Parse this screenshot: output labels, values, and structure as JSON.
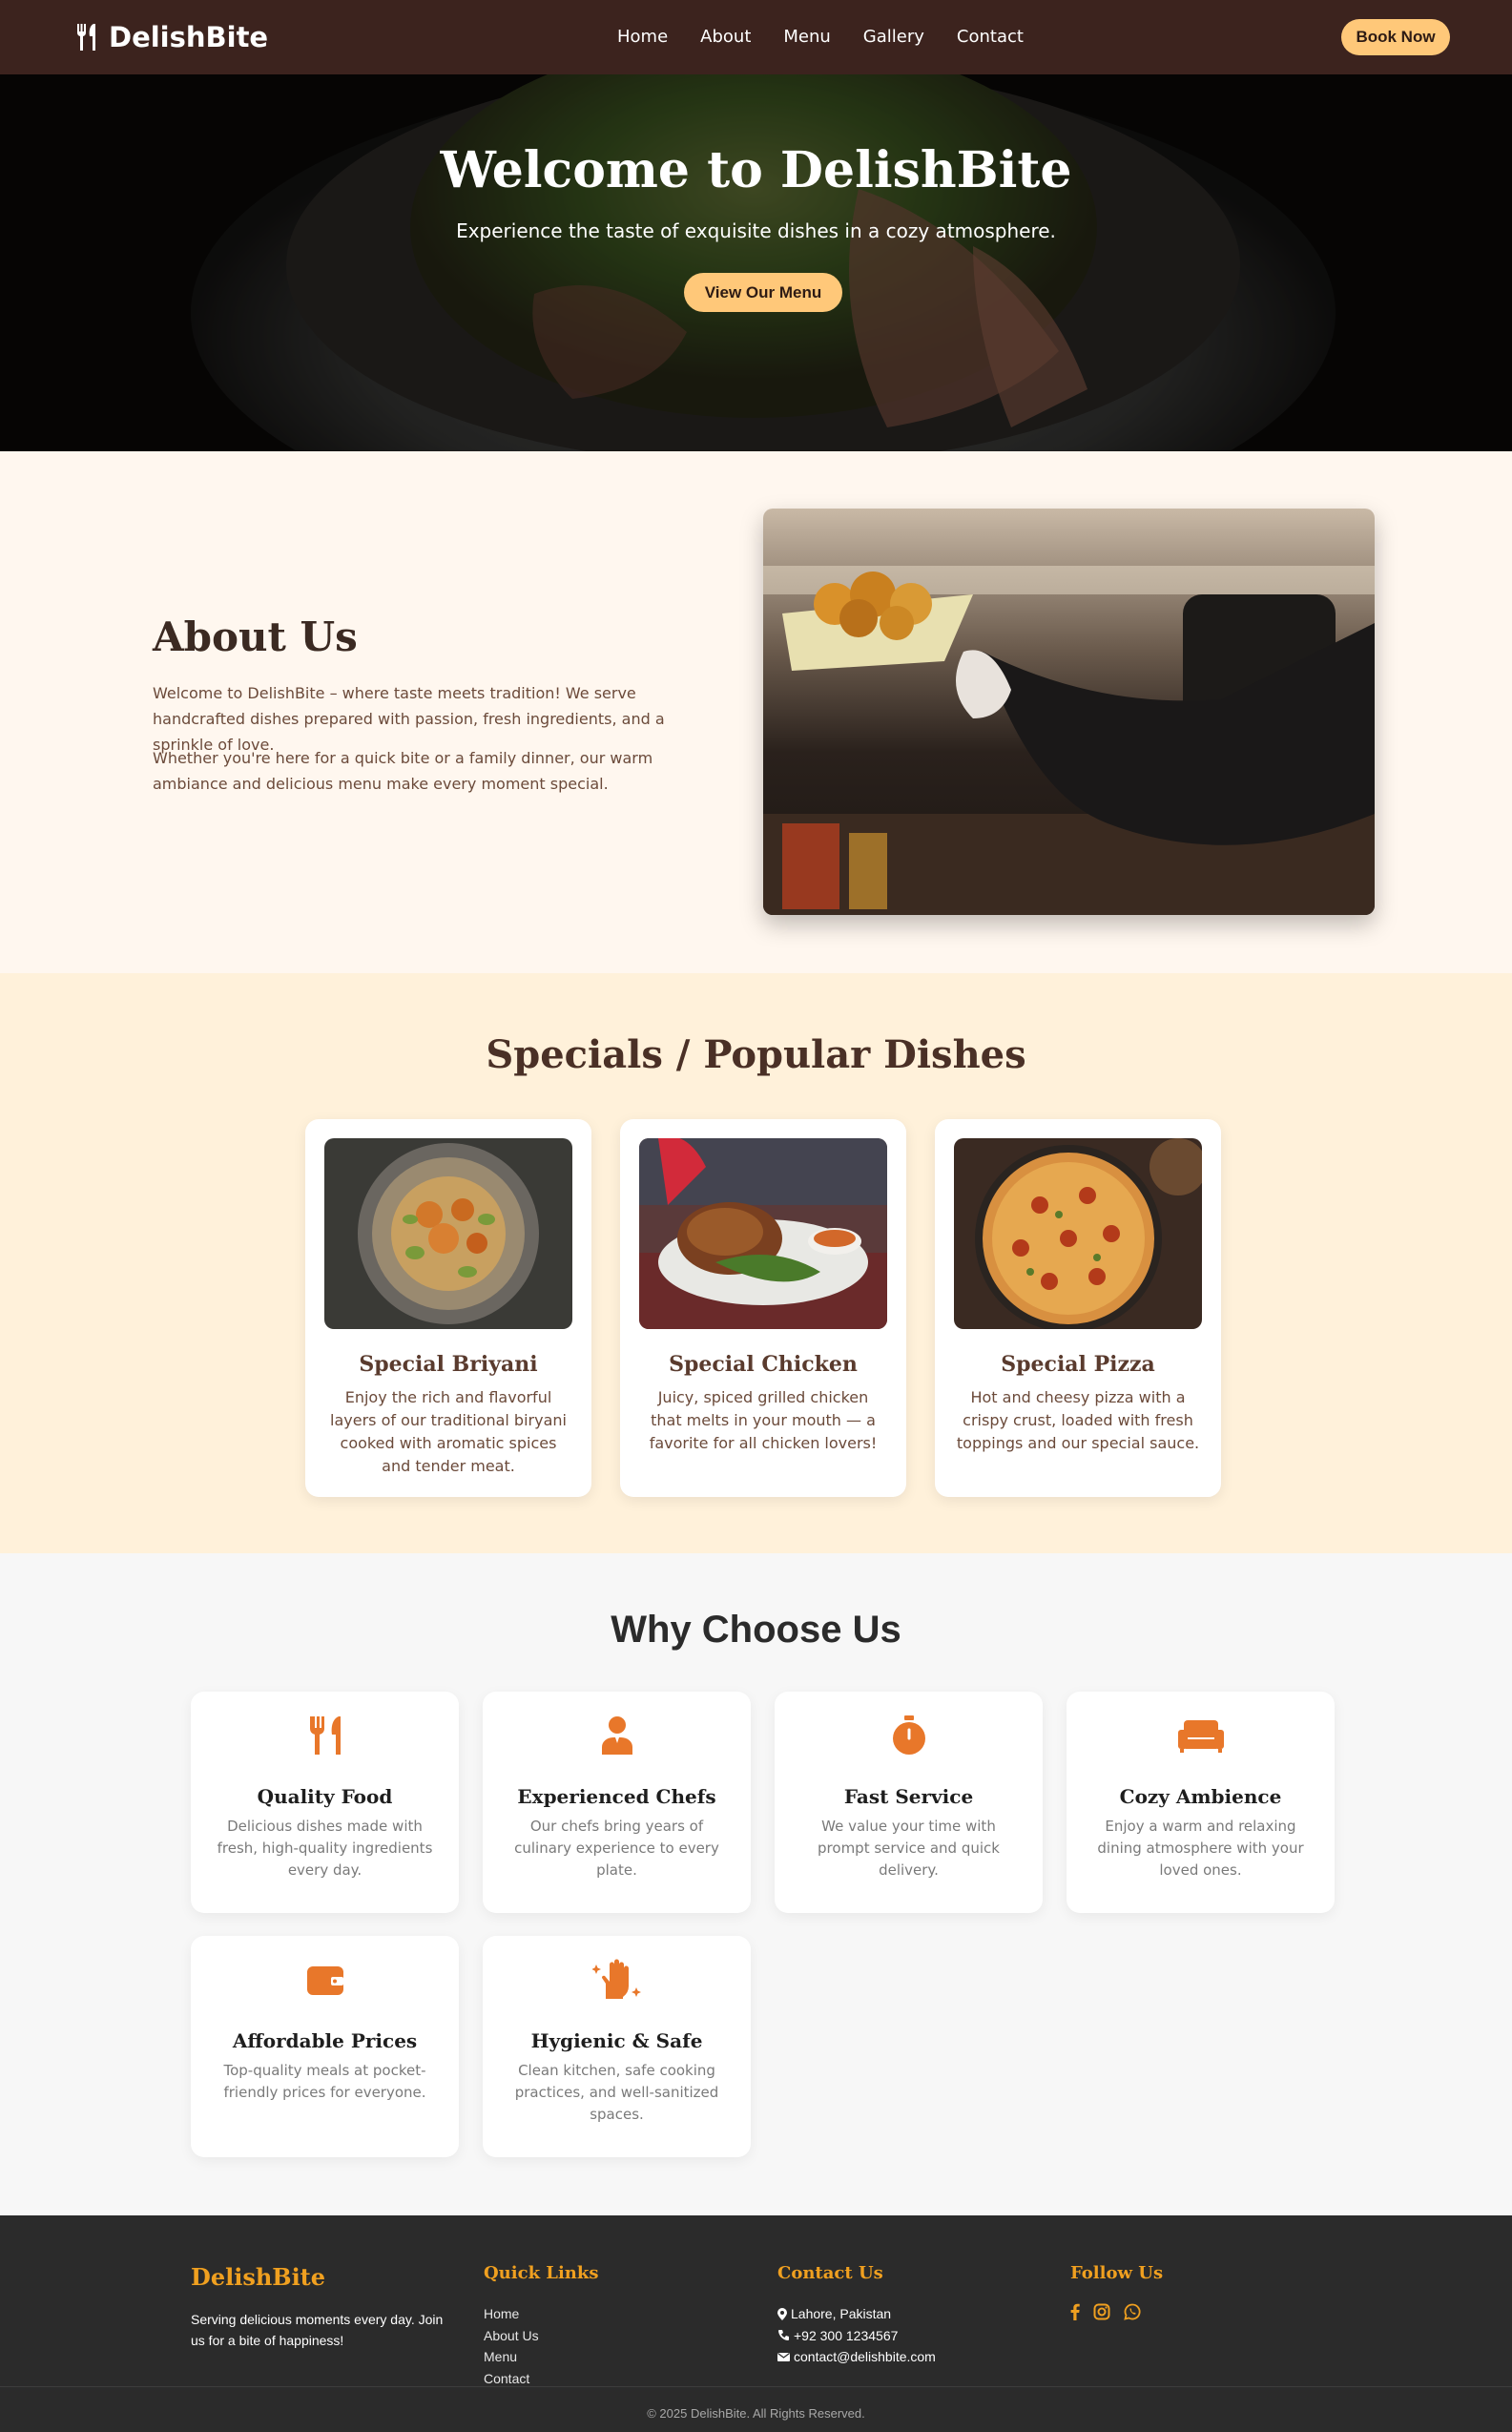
{
  "nav": {
    "brand": "DelishBite",
    "links": [
      "Home",
      "About",
      "Menu",
      "Gallery",
      "Contact"
    ],
    "cta": "Book Now"
  },
  "hero": {
    "title": "Welcome to DelishBite",
    "subtitle": "Experience the taste of exquisite dishes in a cozy atmosphere.",
    "button": "View Our Menu"
  },
  "about": {
    "title": "About Us",
    "p1": "Welcome to DelishBite – where taste meets tradition! We serve handcrafted dishes prepared with passion, fresh ingredients, and a sprinkle of love.",
    "p2": "Whether you're here for a quick bite or a family dinner, our warm ambiance and delicious menu make every moment special."
  },
  "specials": {
    "title": "Specials / Popular Dishes",
    "items": [
      {
        "name": "Special Briyani",
        "desc": "Enjoy the rich and flavorful layers of our traditional biryani cooked with aromatic spices and tender meat."
      },
      {
        "name": "Special Chicken",
        "desc": "Juicy, spiced grilled chicken that melts in your mouth — a favorite for all chicken lovers!"
      },
      {
        "name": "Special Pizza",
        "desc": "Hot and cheesy pizza with a crispy crust, loaded with fresh toppings and our special sauce."
      }
    ]
  },
  "why": {
    "title": "Why Choose Us",
    "items": [
      {
        "name": "Quality Food",
        "desc": "Delicious dishes made with fresh, high-quality ingredients every day.",
        "icon": "utensils-icon"
      },
      {
        "name": "Experienced Chefs",
        "desc": "Our chefs bring years of culinary experience to every plate.",
        "icon": "chef-icon"
      },
      {
        "name": "Fast Service",
        "desc": "We value your time with prompt service and quick delivery.",
        "icon": "stopwatch-icon"
      },
      {
        "name": "Cozy Ambience",
        "desc": "Enjoy a warm and relaxing dining atmosphere with your loved ones.",
        "icon": "couch-icon"
      },
      {
        "name": "Affordable Prices",
        "desc": "Top-quality meals at pocket-friendly prices for everyone.",
        "icon": "wallet-icon"
      },
      {
        "name": "Hygienic & Safe",
        "desc": "Clean kitchen, safe cooking practices, and well-sanitized spaces.",
        "icon": "clean-hands-icon"
      }
    ]
  },
  "footer": {
    "brand": "DelishBite",
    "tagline": "Serving delicious moments every day. Join us for a bite of happiness!",
    "quick_links_title": "Quick Links",
    "quick_links": [
      "Home",
      "About Us",
      "Menu",
      "Contact"
    ],
    "contact_title": "Contact Us",
    "address": "Lahore, Pakistan",
    "phone": "+92 300 1234567",
    "email": "contact@delishbite.com",
    "follow_title": "Follow Us",
    "social": [
      "facebook-icon",
      "instagram-icon",
      "whatsapp-icon"
    ],
    "copyright": "© 2025 DelishBite. All Rights Reserved."
  },
  "colors": {
    "nav_bg": "#3c231e",
    "accent": "#ffc879",
    "icon_orange": "#e8772a",
    "footer_accent": "#f0a020"
  }
}
